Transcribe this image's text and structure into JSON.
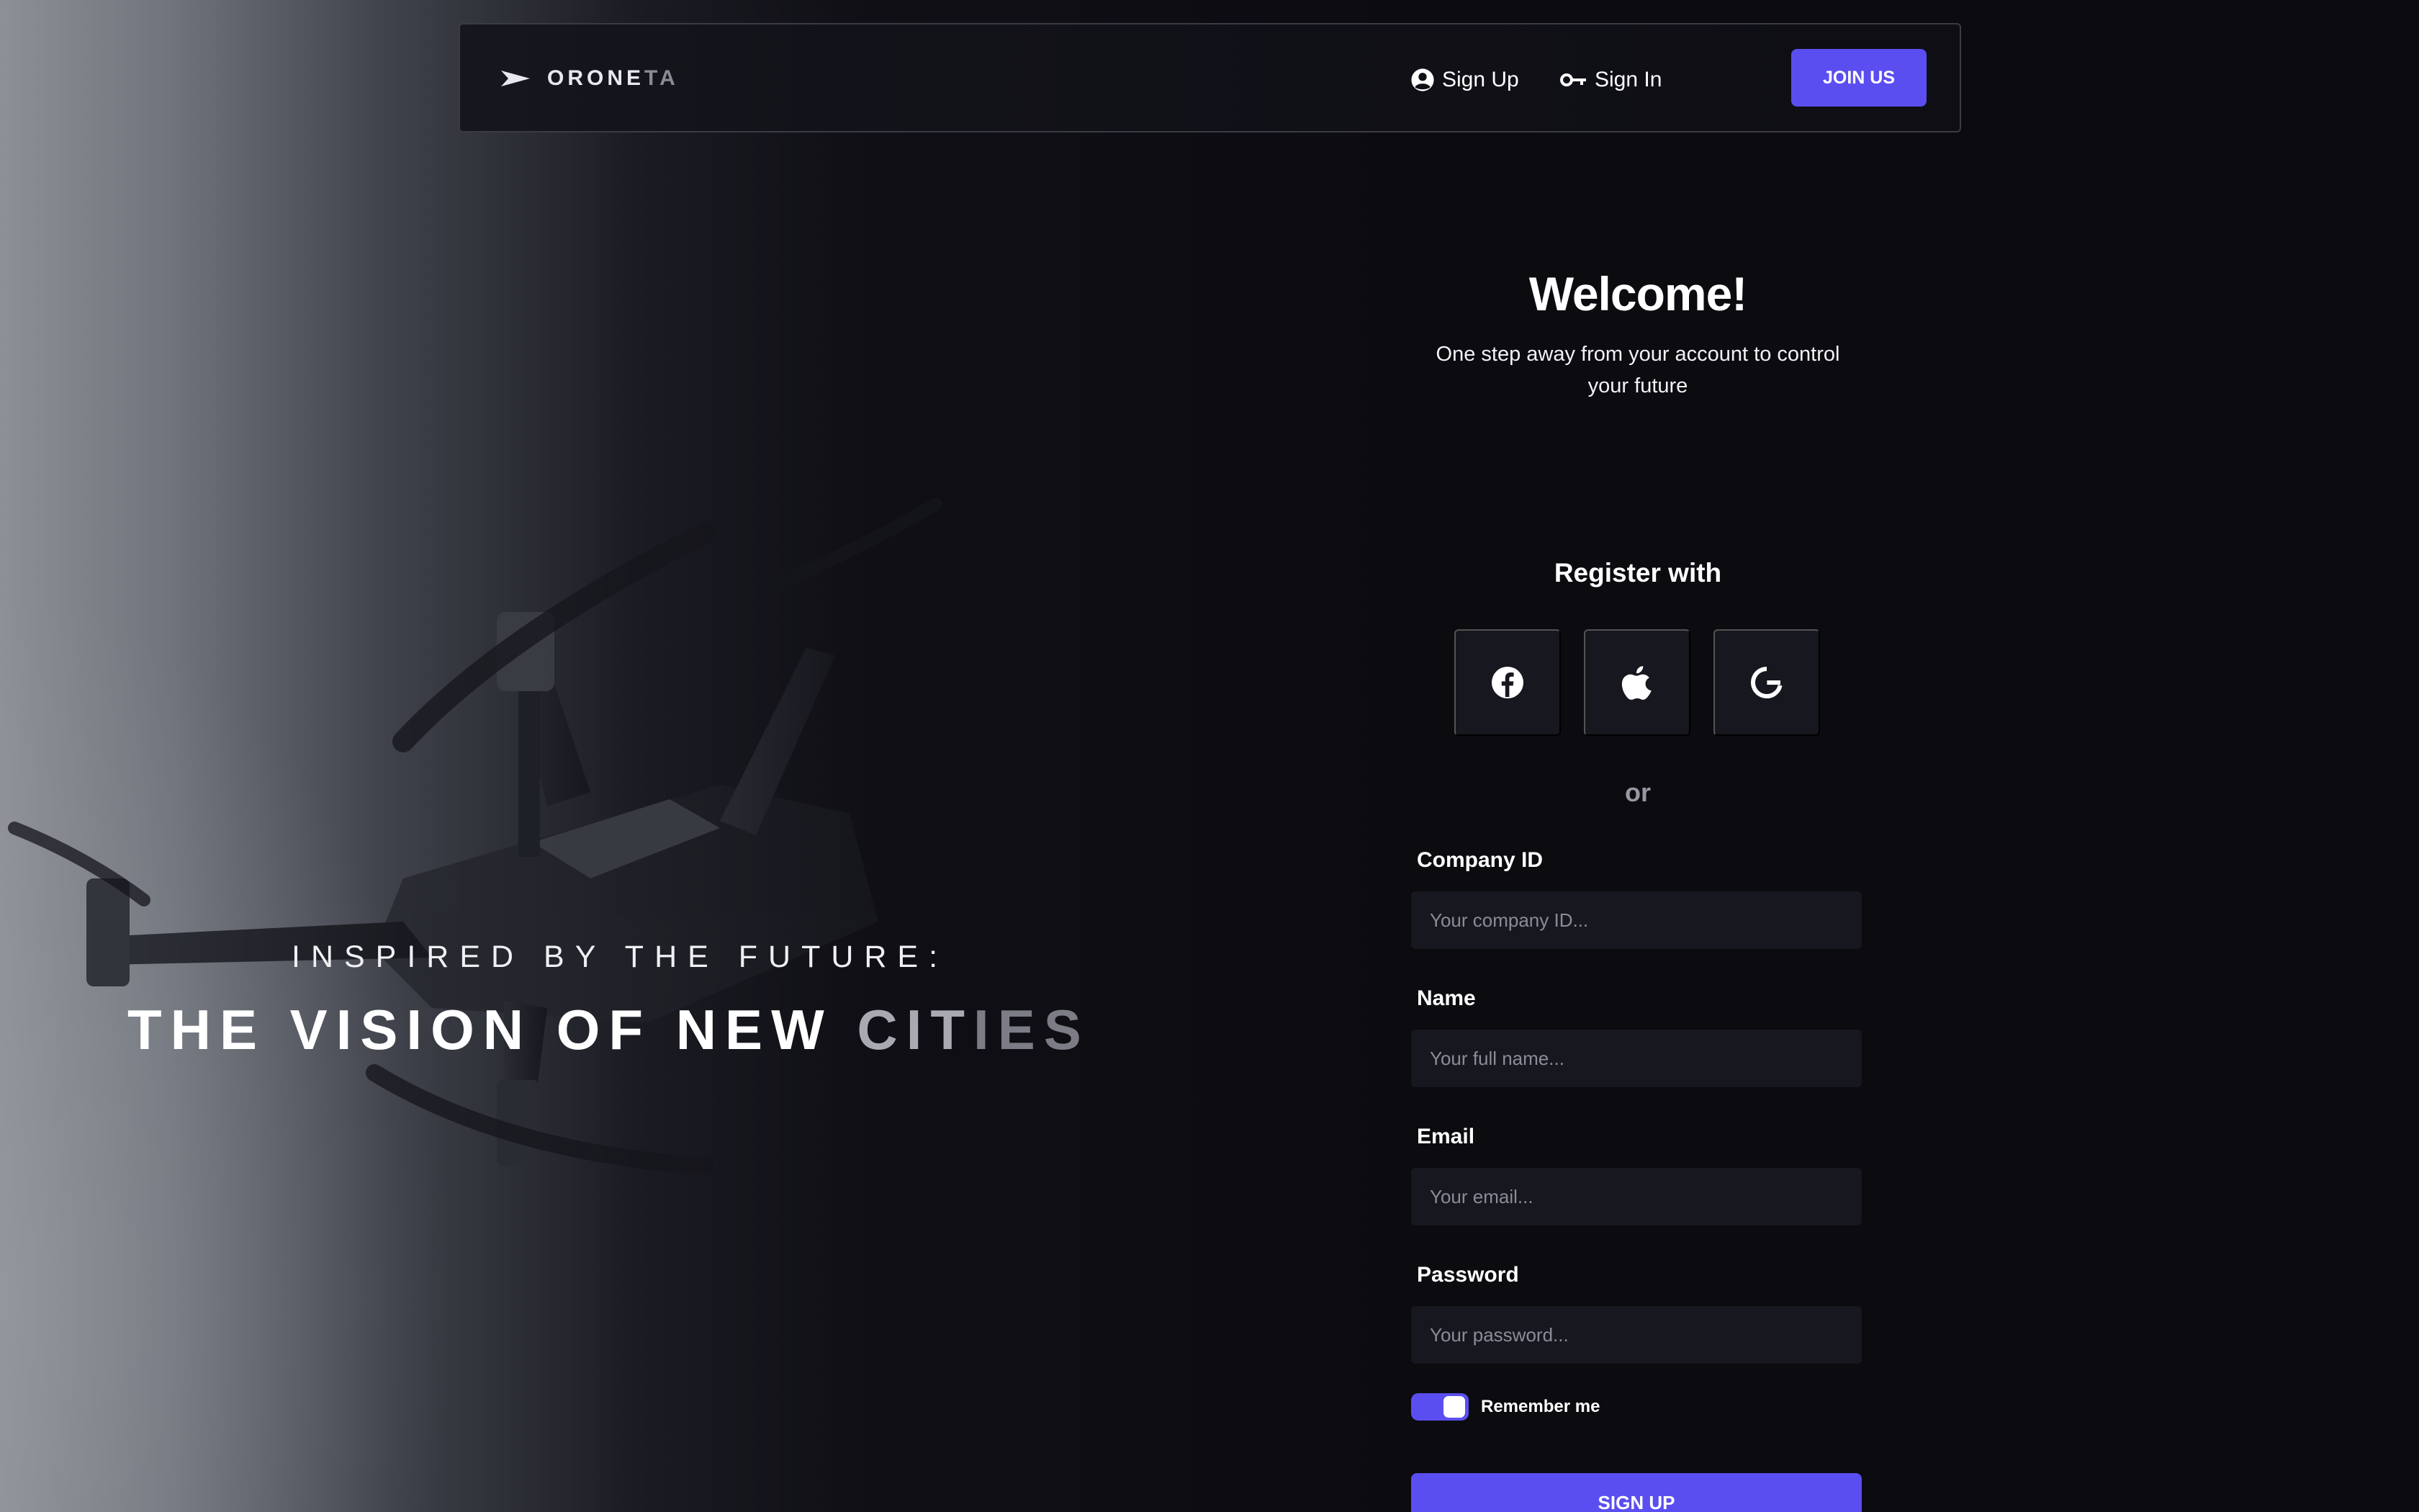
{
  "navbar": {
    "brand_main": "ORONE",
    "brand_fade": "TA",
    "signup_label": "Sign Up",
    "signin_label": "Sign In",
    "join_label": "JOIN US"
  },
  "hero": {
    "eyebrow": "INSPIRED BY THE FUTURE:",
    "title_main": "THE VISION OF NEW ",
    "title_dim": "CIT",
    "title_dimmer": "IES"
  },
  "form": {
    "welcome": "Welcome!",
    "subtitle": "One step away from your account to control your future",
    "register_with": "Register with",
    "social_buttons": [
      {
        "name": "facebook",
        "icon": "facebook-icon"
      },
      {
        "name": "apple",
        "icon": "apple-icon"
      },
      {
        "name": "google",
        "icon": "google-icon"
      }
    ],
    "or": "or",
    "fields": {
      "company": {
        "label": "Company ID",
        "placeholder": "Your company ID..."
      },
      "name": {
        "label": "Name",
        "placeholder": "Your full name..."
      },
      "email": {
        "label": "Email",
        "placeholder": "Your email..."
      },
      "password": {
        "label": "Password",
        "placeholder": "Your password..."
      }
    },
    "remember_label": "Remember me",
    "remember_on": true,
    "submit_label": "SIGN UP"
  },
  "colors": {
    "accent": "#5b4ef0",
    "background": "#0b0b10",
    "input_bg": "#17171f"
  }
}
